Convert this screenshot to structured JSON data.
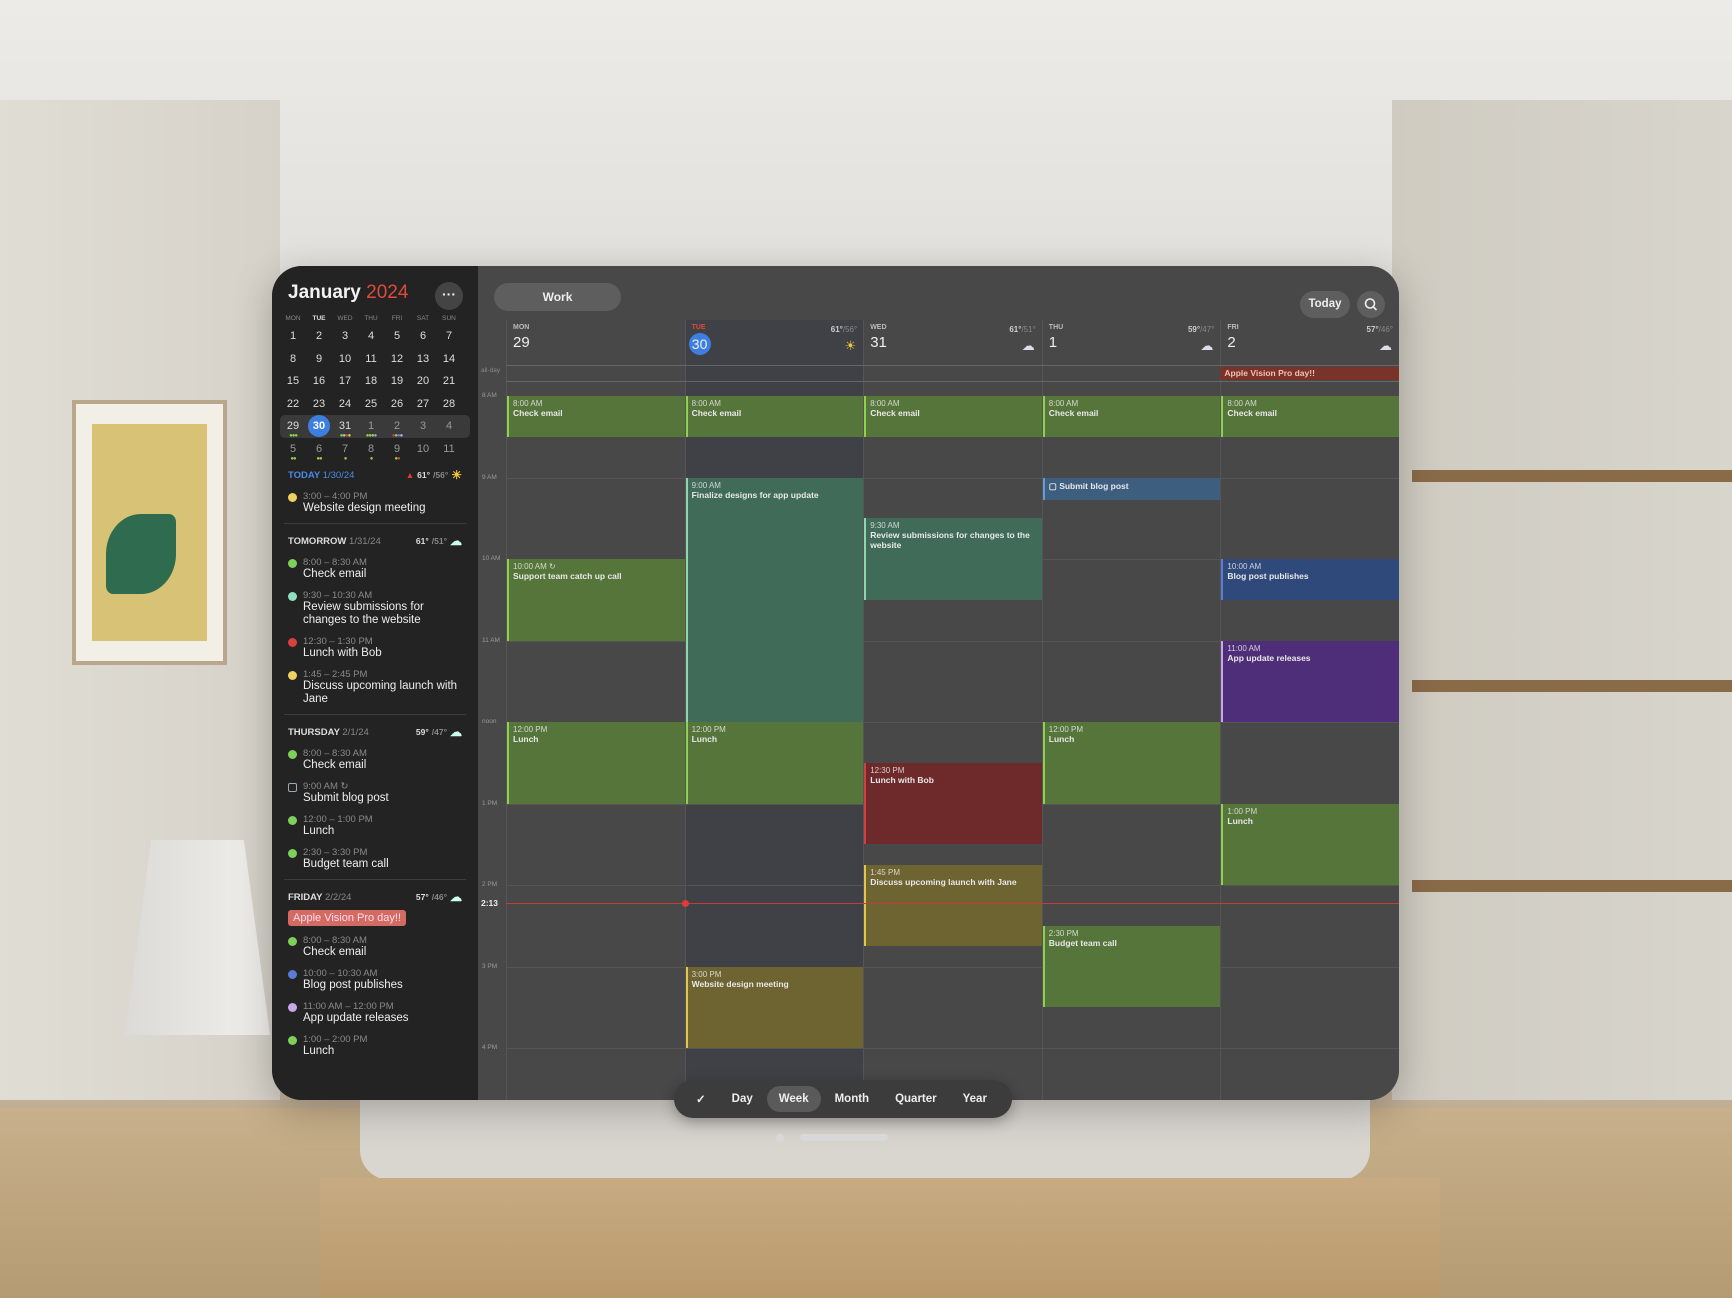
{
  "colors": {
    "accent": "#3d7fe0",
    "year": "#e04a3a",
    "now": "#e03b3b",
    "green": "#56753a",
    "teal": "#3f6b58",
    "red": "#6e2a2a",
    "olive": "#6e6432",
    "blue": "#2f4a7a",
    "purple": "#4e2e78",
    "task": "#3e5e80"
  },
  "sidebar": {
    "month": "January",
    "year": "2024",
    "more_icon": "ellipsis-icon",
    "more_label": "···",
    "weekdays": [
      "MON",
      "TUE",
      "WED",
      "THU",
      "FRI",
      "SAT",
      "SUN"
    ],
    "weeks": [
      [
        {
          "d": "1"
        },
        {
          "d": "2"
        },
        {
          "d": "3"
        },
        {
          "d": "4"
        },
        {
          "d": "5"
        },
        {
          "d": "6"
        },
        {
          "d": "7"
        }
      ],
      [
        {
          "d": "8"
        },
        {
          "d": "9"
        },
        {
          "d": "10"
        },
        {
          "d": "11"
        },
        {
          "d": "12"
        },
        {
          "d": "13"
        },
        {
          "d": "14"
        }
      ],
      [
        {
          "d": "15"
        },
        {
          "d": "16"
        },
        {
          "d": "17"
        },
        {
          "d": "18"
        },
        {
          "d": "19"
        },
        {
          "d": "20"
        },
        {
          "d": "21"
        }
      ],
      [
        {
          "d": "22"
        },
        {
          "d": "23"
        },
        {
          "d": "24"
        },
        {
          "d": "25"
        },
        {
          "d": "26"
        },
        {
          "d": "27"
        },
        {
          "d": "28"
        }
      ],
      [
        {
          "d": "29",
          "dots": [
            "#8fd14f",
            "#8fd14f",
            "#8fd14f"
          ]
        },
        {
          "d": "30",
          "today": true
        },
        {
          "d": "31",
          "dots": [
            "#8fd14f",
            "#8fd6b0",
            "#d04040",
            "#e0c64a"
          ]
        },
        {
          "d": "1",
          "dim": true,
          "dots": [
            "#8fd14f",
            "#8fd14f",
            "#8fd14f",
            "#9ab"
          ]
        },
        {
          "d": "2",
          "dim": true,
          "dots": [
            "#d04040",
            "#8fd14f",
            "#5a7bd6",
            "#c9a6e8"
          ]
        },
        {
          "d": "3",
          "dim": true
        },
        {
          "d": "4",
          "dim": true
        }
      ],
      [
        {
          "d": "5",
          "dim": true,
          "dots": [
            "#8fd14f",
            "#8fd14f"
          ]
        },
        {
          "d": "6",
          "dim": true,
          "dots": [
            "#8fd14f",
            "#8fd14f"
          ]
        },
        {
          "d": "7",
          "dim": true,
          "dots": [
            "#8fd14f"
          ]
        },
        {
          "d": "8",
          "dim": true,
          "dots": [
            "#8fd14f"
          ]
        },
        {
          "d": "9",
          "dim": true,
          "dots": [
            "#8fd14f",
            "#d04040"
          ]
        },
        {
          "d": "10",
          "dim": true
        },
        {
          "d": "11",
          "dim": true
        }
      ]
    ],
    "agenda": [
      {
        "label": "TODAY",
        "date": "1/30/24",
        "today": true,
        "alert_icon": "warning-icon",
        "hi": "61°",
        "lo": "/56°",
        "weather_icon": "sun-icon",
        "banner": "",
        "items": [
          {
            "color": "#f0d060",
            "time": "3:00 – 4:00 PM",
            "title": "Website design meeting"
          }
        ]
      },
      {
        "label": "TOMORROW",
        "date": "1/31/24",
        "hi": "61°",
        "lo": "/51°",
        "weather_icon": "rain-cloud-icon",
        "banner": "",
        "items": [
          {
            "color": "#7ed05a",
            "time": "8:00 – 8:30 AM",
            "title": "Check email"
          },
          {
            "color": "#8fe0c0",
            "time": "9:30 – 10:30 AM",
            "title": "Review submissions for changes to the website"
          },
          {
            "color": "#d94040",
            "time": "12:30 – 1:30 PM",
            "title": "Lunch with Bob"
          },
          {
            "color": "#f0d060",
            "time": "1:45 – 2:45 PM",
            "title": "Discuss upcoming launch with Jane"
          }
        ]
      },
      {
        "label": "THURSDAY",
        "date": "2/1/24",
        "hi": "59°",
        "lo": "/47°",
        "weather_icon": "rain-cloud-icon",
        "banner": "",
        "items": [
          {
            "color": "#7ed05a",
            "time": "8:00 – 8:30 AM",
            "title": "Check email"
          },
          {
            "task": true,
            "time": "9:00 AM ↻",
            "title": "Submit blog post"
          },
          {
            "color": "#7ed05a",
            "time": "12:00 – 1:00 PM",
            "title": "Lunch"
          },
          {
            "color": "#7ed05a",
            "time": "2:30 – 3:30 PM",
            "title": "Budget team call"
          }
        ]
      },
      {
        "label": "FRIDAY",
        "date": "2/2/24",
        "hi": "57°",
        "lo": "/46°",
        "weather_icon": "rain-cloud-icon",
        "banner": "Apple Vision Pro day!!",
        "items": [
          {
            "color": "#7ed05a",
            "time": "8:00 – 8:30 AM",
            "title": "Check email"
          },
          {
            "color": "#5a7bd6",
            "time": "10:00 – 10:30 AM",
            "title": "Blog post publishes"
          },
          {
            "color": "#c9a6e8",
            "time": "11:00 AM – 12:00 PM",
            "title": "App update releases"
          },
          {
            "color": "#7ed05a",
            "time": "1:00 – 2:00 PM",
            "title": "Lunch"
          }
        ]
      }
    ]
  },
  "main": {
    "calendar_filter": "Work",
    "today_label": "Today",
    "search_icon": "search-icon",
    "add_icon": "plus-icon",
    "allday_label": "all-day",
    "hours": [
      "8 AM",
      "9 AM",
      "10 AM",
      "11 AM",
      "noon",
      "1 PM",
      "2 PM",
      "3 PM",
      "4 PM"
    ],
    "now_label": "2:13",
    "now_hour": 14.22,
    "days": [
      {
        "name": "MON",
        "num": "29",
        "hi": "",
        "lo": "",
        "weather_icon": ""
      },
      {
        "name": "TUE",
        "num": "30",
        "today": true,
        "hi": "61°",
        "lo": "/56°",
        "weather_icon": "sun-icon"
      },
      {
        "name": "WED",
        "num": "31",
        "hi": "61°",
        "lo": "/51°",
        "weather_icon": "rain-cloud-icon"
      },
      {
        "name": "THU",
        "num": "1",
        "hi": "59°",
        "lo": "/47°",
        "weather_icon": "rain-cloud-icon"
      },
      {
        "name": "FRI",
        "num": "2",
        "hi": "57°",
        "lo": "/46°",
        "weather_icon": "rain-cloud-icon"
      }
    ],
    "allday_events": [
      {
        "day": 4,
        "title": "Apple Vision Pro day!!",
        "color": "#7a3328"
      }
    ],
    "events": [
      {
        "day": 0,
        "start": 8,
        "end": 8.5,
        "time": "8:00 AM",
        "title": "Check email",
        "kind": "green"
      },
      {
        "day": 0,
        "start": 10,
        "end": 11,
        "time": "10:00 AM ↻",
        "title": "Support team catch up call",
        "kind": "green"
      },
      {
        "day": 0,
        "start": 12,
        "end": 13,
        "time": "12:00 PM",
        "title": "Lunch",
        "kind": "green"
      },
      {
        "day": 1,
        "start": 8,
        "end": 8.5,
        "time": "8:00 AM",
        "title": "Check email",
        "kind": "green"
      },
      {
        "day": 1,
        "start": 9,
        "end": 12,
        "time": "9:00 AM",
        "title": "Finalize designs for app update",
        "kind": "teal"
      },
      {
        "day": 1,
        "start": 12,
        "end": 13,
        "time": "12:00 PM",
        "title": "Lunch",
        "kind": "green"
      },
      {
        "day": 1,
        "start": 15,
        "end": 16,
        "time": "3:00 PM",
        "title": "Website design meeting",
        "kind": "olive"
      },
      {
        "day": 2,
        "start": 8,
        "end": 8.5,
        "time": "8:00 AM",
        "title": "Check email",
        "kind": "green"
      },
      {
        "day": 2,
        "start": 9.5,
        "end": 10.5,
        "time": "9:30 AM",
        "title": "Review submissions for changes to the website",
        "kind": "teal"
      },
      {
        "day": 2,
        "start": 12.5,
        "end": 13.5,
        "time": "12:30 PM",
        "title": "Lunch with Bob",
        "kind": "red"
      },
      {
        "day": 2,
        "start": 13.75,
        "end": 14.75,
        "time": "1:45 PM",
        "title": "Discuss upcoming launch with Jane",
        "kind": "olive"
      },
      {
        "day": 3,
        "start": 8,
        "end": 8.5,
        "time": "8:00 AM",
        "title": "Check email",
        "kind": "green"
      },
      {
        "day": 3,
        "start": 9,
        "end": 9.27,
        "time": "",
        "title": "▢ Submit blog post",
        "kind": "task"
      },
      {
        "day": 3,
        "start": 12,
        "end": 13,
        "time": "12:00 PM",
        "title": "Lunch",
        "kind": "green"
      },
      {
        "day": 3,
        "start": 14.5,
        "end": 15.5,
        "time": "2:30 PM",
        "title": "Budget team call",
        "kind": "green"
      },
      {
        "day": 4,
        "start": 8,
        "end": 8.5,
        "time": "8:00 AM",
        "title": "Check email",
        "kind": "green"
      },
      {
        "day": 4,
        "start": 10,
        "end": 10.5,
        "time": "10:00 AM",
        "title": "Blog post publishes",
        "kind": "blue"
      },
      {
        "day": 4,
        "start": 11,
        "end": 12,
        "time": "11:00 AM",
        "title": "App update releases",
        "kind": "purple"
      },
      {
        "day": 4,
        "start": 13,
        "end": 14,
        "time": "1:00 PM",
        "title": "Lunch",
        "kind": "green"
      }
    ]
  },
  "toolbar": {
    "check_icon": "checkmark-icon",
    "check_label": "✓",
    "views": [
      "Day",
      "Week",
      "Month",
      "Quarter",
      "Year"
    ],
    "selected": "Week"
  }
}
